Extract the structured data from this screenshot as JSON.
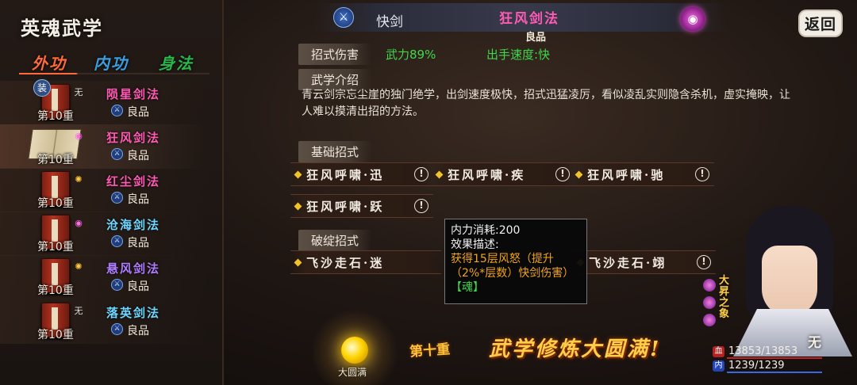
{
  "left_panel": {
    "title": "英魂武学",
    "tabs": [
      {
        "label": "外功",
        "active": true
      },
      {
        "label": "内功",
        "active": false
      },
      {
        "label": "身法",
        "active": false
      }
    ],
    "skills": [
      {
        "name": "陨星剑法",
        "quality": "良品",
        "level": "第10重",
        "element_icon": "无",
        "equipped_badge": "装",
        "name_color": "#ff5ab4"
      },
      {
        "name": "狂风剑法",
        "quality": "良品",
        "level": "第10重",
        "element_icon": "vortex-icon",
        "name_color": "#ff5ab4",
        "selected": true
      },
      {
        "name": "红尘剑法",
        "quality": "良品",
        "level": "第10重",
        "element_icon": "sun-icon",
        "name_color": "#ff5ab4"
      },
      {
        "name": "沧海剑法",
        "quality": "良品",
        "level": "第10重",
        "element_icon": "vortex-icon",
        "name_color": "#6fd6ff"
      },
      {
        "name": "悬风剑法",
        "quality": "良品",
        "level": "第10重",
        "element_icon": "sun-icon",
        "name_color": "#b07cff"
      },
      {
        "name": "落英剑法",
        "quality": "良品",
        "level": "第10重",
        "element_icon": "无",
        "name_color": "#6fd6ff"
      }
    ]
  },
  "header": {
    "weapon": "快剑",
    "skill_title": "狂风剑法",
    "quality": "良品",
    "back_label": "返回"
  },
  "stats": {
    "damage_label": "招式伤害",
    "power": "武力89%",
    "speed": "出手速度:快"
  },
  "intro": {
    "label": "武学介绍",
    "description": "青云剑宗忘尘崖的独门绝学，出剑速度极快，招式迅猛凌厉，看似凌乱实则隐含杀机，虚实掩映，让人难以摸清出招的方法。"
  },
  "basic_moves": {
    "label": "基础招式",
    "moves": [
      "狂风呼啸·迅",
      "狂风呼啸·疾",
      "狂风呼啸·驰",
      "狂风呼啸·跃"
    ],
    "info_glyph": "!"
  },
  "break_moves": {
    "label": "破绽招式",
    "moves": [
      "飞沙走石·迷",
      "飞沙走石·翊"
    ]
  },
  "tooltip": {
    "cost": "内力消耗:200",
    "effect_label": "效果描述:",
    "effect": "获得15层风怒（提升（2%*层数）快剑伤害）",
    "soul_tag": "【魂】"
  },
  "mastery": {
    "orb_label": "大圆满",
    "rank": "第十重",
    "complete_text": "武学修炼大圆满!"
  },
  "character": {
    "title_vertical": "大昇之象",
    "tag": "无",
    "hp": "13853/13853",
    "mp": "1239/1239",
    "hp_fraction": 1.0,
    "mp_fraction": 1.0
  },
  "colors": {
    "accent_pink": "#ff5ab4",
    "green_value": "#40d84a",
    "orange_effect": "#f2a417",
    "gold": "#ffcf4a"
  }
}
